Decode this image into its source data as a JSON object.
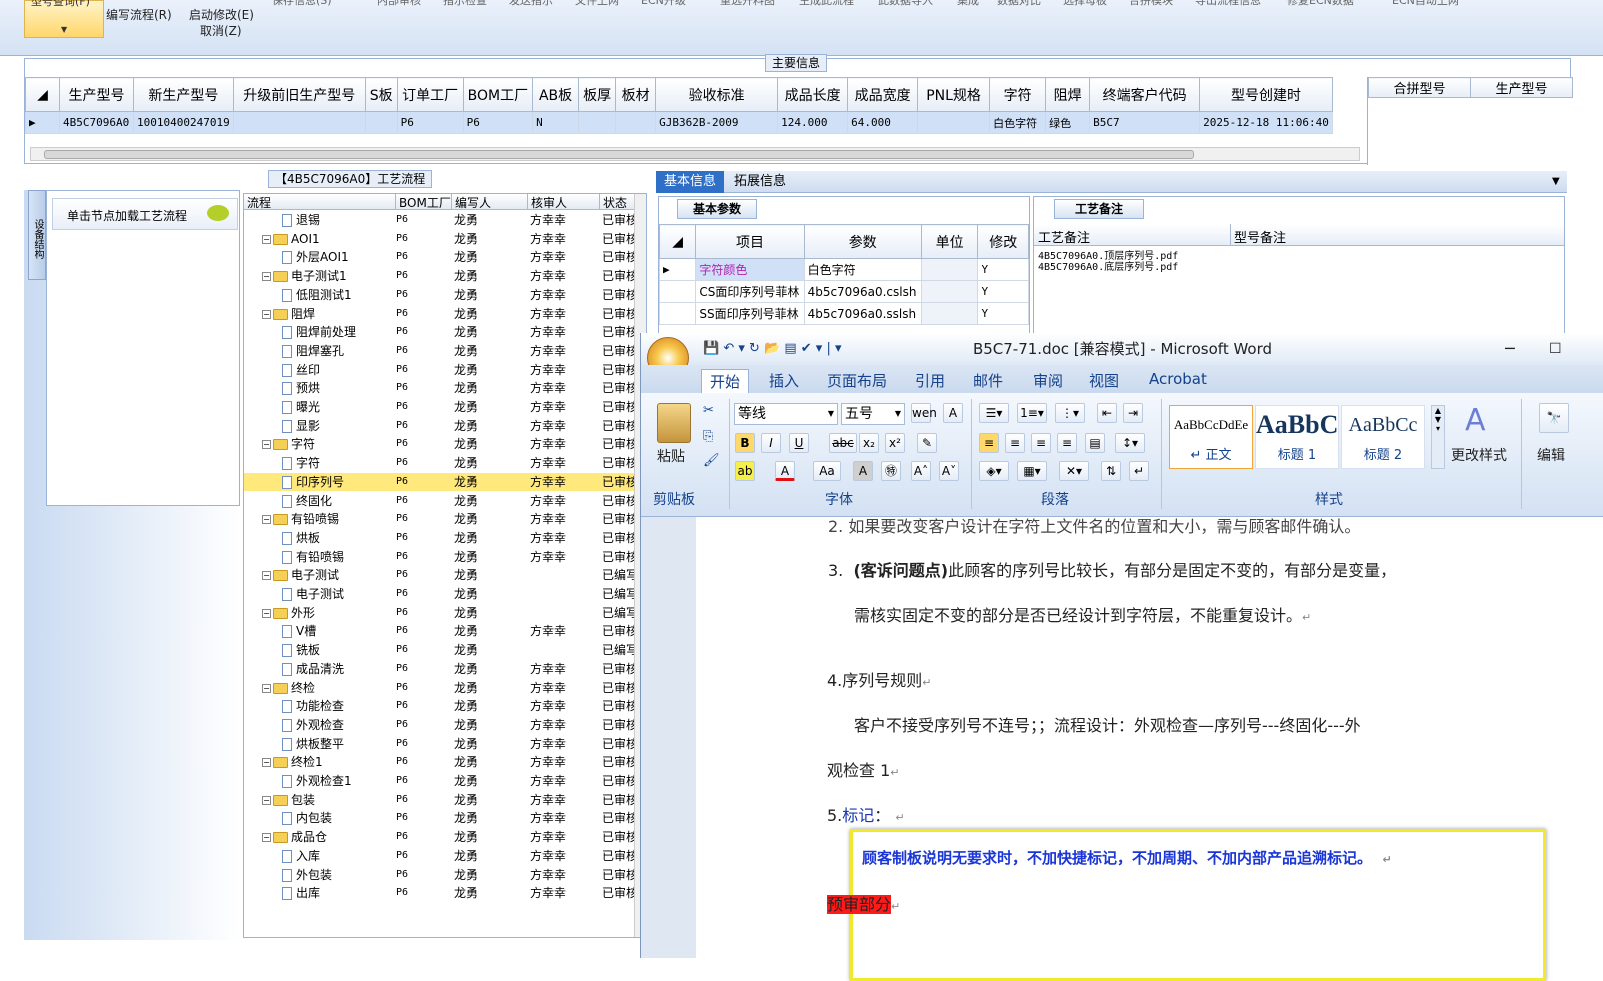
{
  "toolbar": {
    "query_btn": "型号查询(F)",
    "edit_flow": "编写流程(R)",
    "start_modify": "启动修改(E)",
    "cancel": "取消(Z)",
    "top_items": [
      "保存信息(S)",
      "内部审核",
      "指示检查",
      "发送指示",
      "文件上网",
      "ECN升级",
      "重选开料图",
      "生成此流程",
      "此数据导入",
      "集成",
      "数据对比",
      "选择母板",
      "合拼模块",
      "导出流程信息",
      "修复ECN数据",
      "ECN自动上网"
    ]
  },
  "main_info": {
    "title": "主要信息",
    "columns": [
      "生产型号",
      "新生产型号",
      "升级前旧生产型号",
      "S板",
      "订单工厂",
      "BOM工厂",
      "AB板",
      "板厚",
      "板材",
      "验收标准",
      "成品长度",
      "成品宽度",
      "PNL规格",
      "字符",
      "阻焊",
      "终端客户代码",
      "型号创建时"
    ],
    "row": [
      "4B5C7096A0",
      "10010400247019",
      "",
      "",
      "P6",
      "P6",
      "N",
      "",
      "",
      "GJB362B-2009",
      "124.000",
      "64.000",
      "",
      "白色字符",
      "绿色",
      "B5C7",
      "2025-12-18 11:06:40"
    ],
    "right_columns": [
      "合拼型号",
      "生产型号"
    ]
  },
  "left_panel": {
    "side_tab": "设备结构",
    "head": "单击节点加载工艺流程"
  },
  "process": {
    "title": "【4B5C7096A0】工艺流程",
    "columns": [
      "流程",
      "BOM工厂",
      "编写人",
      "核审人",
      "状态"
    ],
    "rows": [
      {
        "level": 2,
        "type": "doc",
        "name": "退锡",
        "bom": "P6",
        "writer": "龙勇",
        "reviewer": "方幸幸",
        "status": "已审核"
      },
      {
        "level": 1,
        "type": "folder",
        "name": "AOI1",
        "bom": "P6",
        "writer": "龙勇",
        "reviewer": "方幸幸",
        "status": "已审核"
      },
      {
        "level": 2,
        "type": "doc",
        "name": "外层AOI1",
        "bom": "P6",
        "writer": "龙勇",
        "reviewer": "方幸幸",
        "status": "已审核"
      },
      {
        "level": 1,
        "type": "folder",
        "name": "电子测试1",
        "bom": "P6",
        "writer": "龙勇",
        "reviewer": "方幸幸",
        "status": "已审核"
      },
      {
        "level": 2,
        "type": "doc",
        "name": "低阻测试1",
        "bom": "P6",
        "writer": "龙勇",
        "reviewer": "方幸幸",
        "status": "已审核"
      },
      {
        "level": 1,
        "type": "folder",
        "name": "阻焊",
        "bom": "P6",
        "writer": "龙勇",
        "reviewer": "方幸幸",
        "status": "已审核"
      },
      {
        "level": 2,
        "type": "doc",
        "name": "阻焊前处理",
        "bom": "P6",
        "writer": "龙勇",
        "reviewer": "方幸幸",
        "status": "已审核"
      },
      {
        "level": 2,
        "type": "doc",
        "name": "阻焊塞孔",
        "bom": "P6",
        "writer": "龙勇",
        "reviewer": "方幸幸",
        "status": "已审核"
      },
      {
        "level": 2,
        "type": "doc",
        "name": "丝印",
        "bom": "P6",
        "writer": "龙勇",
        "reviewer": "方幸幸",
        "status": "已审核"
      },
      {
        "level": 2,
        "type": "doc",
        "name": "预烘",
        "bom": "P6",
        "writer": "龙勇",
        "reviewer": "方幸幸",
        "status": "已审核"
      },
      {
        "level": 2,
        "type": "doc",
        "name": "曝光",
        "bom": "P6",
        "writer": "龙勇",
        "reviewer": "方幸幸",
        "status": "已审核"
      },
      {
        "level": 2,
        "type": "doc",
        "name": "显影",
        "bom": "P6",
        "writer": "龙勇",
        "reviewer": "方幸幸",
        "status": "已审核"
      },
      {
        "level": 1,
        "type": "folder",
        "name": "字符",
        "bom": "P6",
        "writer": "龙勇",
        "reviewer": "方幸幸",
        "status": "已审核"
      },
      {
        "level": 2,
        "type": "doc",
        "name": "字符",
        "bom": "P6",
        "writer": "龙勇",
        "reviewer": "方幸幸",
        "status": "已审核"
      },
      {
        "level": 2,
        "type": "doc",
        "name": "印序列号",
        "bom": "P6",
        "writer": "龙勇",
        "reviewer": "方幸幸",
        "status": "已审核",
        "selected": true
      },
      {
        "level": 2,
        "type": "doc",
        "name": "终固化",
        "bom": "P6",
        "writer": "龙勇",
        "reviewer": "方幸幸",
        "status": "已审核"
      },
      {
        "level": 1,
        "type": "folder",
        "name": "有铅喷锡",
        "bom": "P6",
        "writer": "龙勇",
        "reviewer": "方幸幸",
        "status": "已审核"
      },
      {
        "level": 2,
        "type": "doc",
        "name": "烘板",
        "bom": "P6",
        "writer": "龙勇",
        "reviewer": "方幸幸",
        "status": "已审核"
      },
      {
        "level": 2,
        "type": "doc",
        "name": "有铅喷锡",
        "bom": "P6",
        "writer": "龙勇",
        "reviewer": "方幸幸",
        "status": "已审核"
      },
      {
        "level": 1,
        "type": "folder",
        "name": "电子测试",
        "bom": "P6",
        "writer": "龙勇",
        "reviewer": "",
        "status": "已编写"
      },
      {
        "level": 2,
        "type": "doc",
        "name": "电子测试",
        "bom": "P6",
        "writer": "龙勇",
        "reviewer": "",
        "status": "已编写"
      },
      {
        "level": 1,
        "type": "folder",
        "name": "外形",
        "bom": "P6",
        "writer": "龙勇",
        "reviewer": "",
        "status": "已编写"
      },
      {
        "level": 2,
        "type": "doc",
        "name": "V槽",
        "bom": "P6",
        "writer": "龙勇",
        "reviewer": "方幸幸",
        "status": "已审核"
      },
      {
        "level": 2,
        "type": "doc",
        "name": "铣板",
        "bom": "P6",
        "writer": "龙勇",
        "reviewer": "",
        "status": "已编写"
      },
      {
        "level": 2,
        "type": "doc",
        "name": "成品清洗",
        "bom": "P6",
        "writer": "龙勇",
        "reviewer": "方幸幸",
        "status": "已审核"
      },
      {
        "level": 1,
        "type": "folder",
        "name": "终检",
        "bom": "P6",
        "writer": "龙勇",
        "reviewer": "方幸幸",
        "status": "已审核"
      },
      {
        "level": 2,
        "type": "doc",
        "name": "功能检查",
        "bom": "P6",
        "writer": "龙勇",
        "reviewer": "方幸幸",
        "status": "已审核"
      },
      {
        "level": 2,
        "type": "doc",
        "name": "外观检查",
        "bom": "P6",
        "writer": "龙勇",
        "reviewer": "方幸幸",
        "status": "已审核"
      },
      {
        "level": 2,
        "type": "doc",
        "name": "烘板整平",
        "bom": "P6",
        "writer": "龙勇",
        "reviewer": "方幸幸",
        "status": "已审核"
      },
      {
        "level": 1,
        "type": "folder",
        "name": "终检1",
        "bom": "P6",
        "writer": "龙勇",
        "reviewer": "方幸幸",
        "status": "已审核"
      },
      {
        "level": 2,
        "type": "doc",
        "name": "外观检查1",
        "bom": "P6",
        "writer": "龙勇",
        "reviewer": "方幸幸",
        "status": "已审核"
      },
      {
        "level": 1,
        "type": "folder",
        "name": "包装",
        "bom": "P6",
        "writer": "龙勇",
        "reviewer": "方幸幸",
        "status": "已审核"
      },
      {
        "level": 2,
        "type": "doc",
        "name": "内包装",
        "bom": "P6",
        "writer": "龙勇",
        "reviewer": "方幸幸",
        "status": "已审核"
      },
      {
        "level": 1,
        "type": "folder",
        "name": "成品仓",
        "bom": "P6",
        "writer": "龙勇",
        "reviewer": "方幸幸",
        "status": "已审核"
      },
      {
        "level": 2,
        "type": "doc",
        "name": "入库",
        "bom": "P6",
        "writer": "龙勇",
        "reviewer": "方幸幸",
        "status": "已审核"
      },
      {
        "level": 2,
        "type": "doc",
        "name": "外包装",
        "bom": "P6",
        "writer": "龙勇",
        "reviewer": "方幸幸",
        "status": "已审核"
      },
      {
        "level": 2,
        "type": "doc",
        "name": "出库",
        "bom": "P6",
        "writer": "龙勇",
        "reviewer": "方幸幸",
        "status": "已审核"
      }
    ]
  },
  "right_tabs": {
    "basic": "基本信息",
    "extended": "拓展信息"
  },
  "basic_params": {
    "title": "基本参数",
    "columns": [
      "项目",
      "参数",
      "单位",
      "修改"
    ],
    "rows": [
      {
        "item": "字符颜色",
        "param": "白色字符",
        "unit": "",
        "modify": "Y"
      },
      {
        "item": "CS面印序列号菲林",
        "param": "4b5c7096a0.cslsh",
        "unit": "",
        "modify": "Y"
      },
      {
        "item": "SS面印序列号菲林",
        "param": "4b5c7096a0.sslsh",
        "unit": "",
        "modify": "Y"
      }
    ]
  },
  "process_remark": {
    "title": "工艺备注",
    "columns": [
      "工艺备注",
      "型号备注"
    ],
    "lines": [
      "4B5C7096A0.顶层序列号.pdf",
      "4B5C7096A0.底层序列号.pdf"
    ]
  },
  "word": {
    "title": "B5C7-71.doc [兼容模式] - Microsoft Word",
    "tabs": [
      "开始",
      "插入",
      "页面布局",
      "引用",
      "邮件",
      "审阅",
      "视图",
      "Acrobat"
    ],
    "font_name": "等线",
    "font_size": "五号",
    "groups": {
      "clipboard": "剪贴板",
      "font": "字体",
      "paragraph": "段落",
      "styles": "样式"
    },
    "paste": "粘贴",
    "styles": [
      {
        "preview": "AaBbCcDdEe",
        "name": "↵ 正文"
      },
      {
        "preview": "AaBbC",
        "name": "标题 1"
      },
      {
        "preview": "AaBbCc",
        "name": "标题 2"
      }
    ],
    "change_styles": "更改样式",
    "edit": "编辑",
    "doc": {
      "line_2": "2.  如果要改变客户设计在字符上文件名的位置和大小，需与顾客邮件确认。",
      "line_3_num": "3.",
      "line_3_bold": "(客诉问题点)",
      "line_3_rest": "此顾客的序列号比较长，有部分是固定不变的，有部分是变量，",
      "line_3_cont": "需核实固定不变的部分是否已经设计到字符层，不能重复设计。",
      "sec4_title": "4.序列号规则",
      "sec4_body1": "客户不接受序列号不连号；；流程设计：外观检查—序列号---终固化---外",
      "sec4_body2": "观检查 1",
      "sec5_num": "5.",
      "sec5_title": "标记",
      "sec5_colon": "：",
      "sec5_body": "顾客制板说明无要求时，不加快捷标记，不加周期、不加内部产品追溯标记。",
      "prereview": "预审部分"
    }
  }
}
